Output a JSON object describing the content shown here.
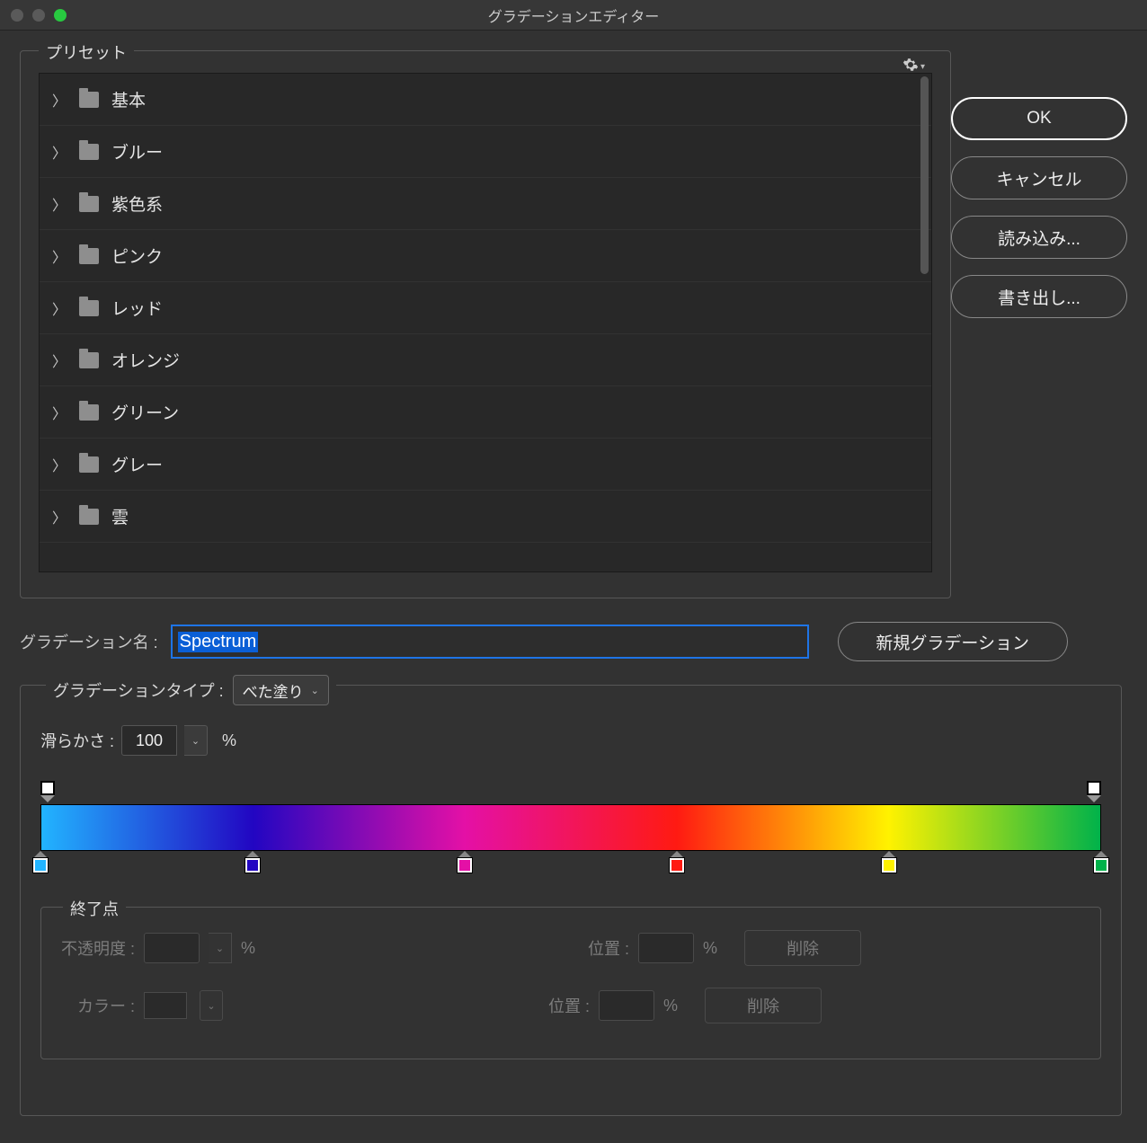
{
  "window": {
    "title": "グラデーションエディター"
  },
  "buttons": {
    "ok": "OK",
    "cancel": "キャンセル",
    "load": "読み込み...",
    "save": "書き出し...",
    "new_gradient": "新規グラデーション"
  },
  "presets": {
    "legend": "プリセット",
    "items": [
      {
        "label": "基本"
      },
      {
        "label": "ブルー"
      },
      {
        "label": "紫色系"
      },
      {
        "label": "ピンク"
      },
      {
        "label": "レッド"
      },
      {
        "label": "オレンジ"
      },
      {
        "label": "グリーン"
      },
      {
        "label": "グレー"
      },
      {
        "label": "雲"
      }
    ]
  },
  "name": {
    "label": "グラデーション名 :",
    "value": "Spectrum"
  },
  "type": {
    "label": "グラデーションタイプ :",
    "value": "べた塗り"
  },
  "smooth": {
    "label": "滑らかさ :",
    "value": "100",
    "unit": "%"
  },
  "gradient": {
    "opacity_stops": [
      {
        "pos": 0,
        "color": "#ffffff"
      },
      {
        "pos": 100,
        "color": "#ffffff"
      }
    ],
    "color_stops": [
      {
        "pos": 0,
        "color": "#22b4ff"
      },
      {
        "pos": 20,
        "color": "#2206c2"
      },
      {
        "pos": 40,
        "color": "#e410a6"
      },
      {
        "pos": 60,
        "color": "#ff1a12"
      },
      {
        "pos": 80,
        "color": "#fff200"
      },
      {
        "pos": 100,
        "color": "#00b24a"
      }
    ]
  },
  "endpoint": {
    "legend": "終了点",
    "opacity_label": "不透明度 :",
    "position_label": "位置 :",
    "color_label": "カラー :",
    "percent": "%",
    "delete": "削除"
  }
}
